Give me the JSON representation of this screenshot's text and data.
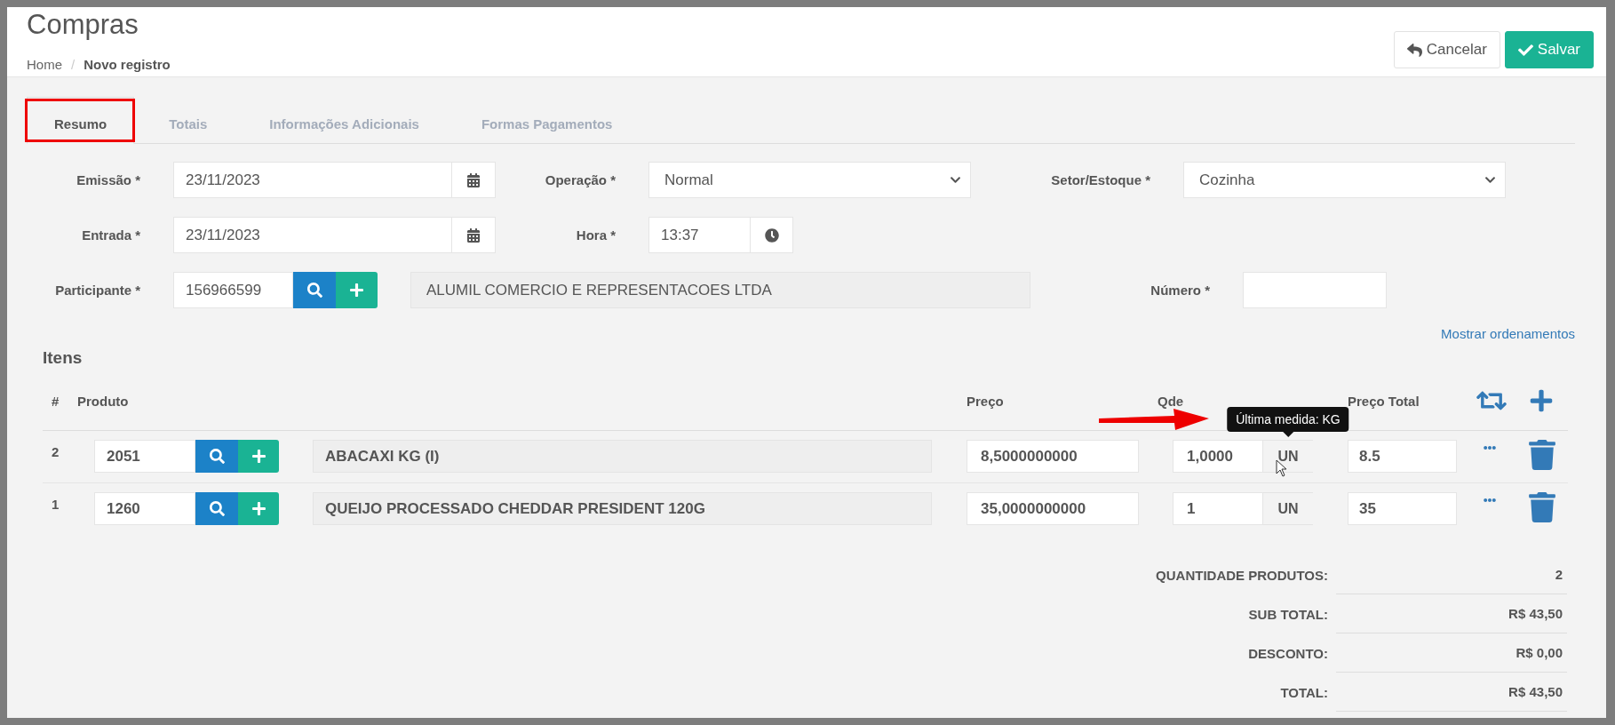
{
  "header": {
    "title": "Compras",
    "separator": "/",
    "breadcrumb": [
      {
        "label": "Home",
        "current": false
      },
      {
        "label": "Novo registro",
        "current": true
      }
    ]
  },
  "actions": [
    {
      "kind": "cancel",
      "label": "Cancelar"
    },
    {
      "kind": "save",
      "label": "Salvar"
    }
  ],
  "tabs": [
    {
      "label": "Resumo",
      "selected": true
    },
    {
      "label": "Totais",
      "selected": false
    },
    {
      "label": "Informações Adicionais",
      "selected": false
    },
    {
      "label": "Formas Pagamentos",
      "selected": false
    }
  ],
  "form": [
    [
      {
        "kind": "date",
        "label": "Emissão *",
        "value": "23/11/2023"
      },
      {
        "kind": "select",
        "label": "Operação *",
        "value": "Normal"
      },
      {
        "kind": "select",
        "label": "Setor/Estoque *",
        "value": "Cozinha"
      }
    ],
    [
      {
        "kind": "date",
        "label": "Entrada *",
        "value": "23/11/2023"
      },
      {
        "kind": "time",
        "label": "Hora *",
        "value": "13:37"
      }
    ],
    [
      {
        "kind": "lookup",
        "label": "Participante *",
        "value": "156966599",
        "name": "ALUMIL COMERCIO E REPRESENTACOES LTDA"
      },
      {
        "kind": "text",
        "label": "Número *"
      }
    ]
  ],
  "sort_link": "Mostrar ordenamentos",
  "items": {
    "title": "Itens",
    "columns": [
      "#",
      "Produto",
      "Preço",
      "Qde",
      "Preço Total"
    ],
    "rows": [
      {
        "number": "2",
        "code": "2051",
        "name": "ABACAXI KG (I)",
        "price": "8,5000000000",
        "quantity": "1,0000",
        "unit": "UN",
        "total": "8.5",
        "tooltip": "Última medida: KG"
      },
      {
        "number": "1",
        "code": "1260",
        "name": "QUEIJO PROCESSADO CHEDDAR PRESIDENT 120G",
        "price": "35,0000000000",
        "quantity": "1",
        "unit": "UN",
        "total": "35"
      }
    ]
  },
  "totals": [
    {
      "label": "QUANTIDADE PRODUTOS:",
      "value": "2"
    },
    {
      "label": "SUB TOTAL:",
      "value": "R$ 43,50"
    },
    {
      "label": "DESCONTO:",
      "value": "R$ 0,00"
    },
    {
      "label": "TOTAL:",
      "value": "R$ 43,50"
    }
  ]
}
